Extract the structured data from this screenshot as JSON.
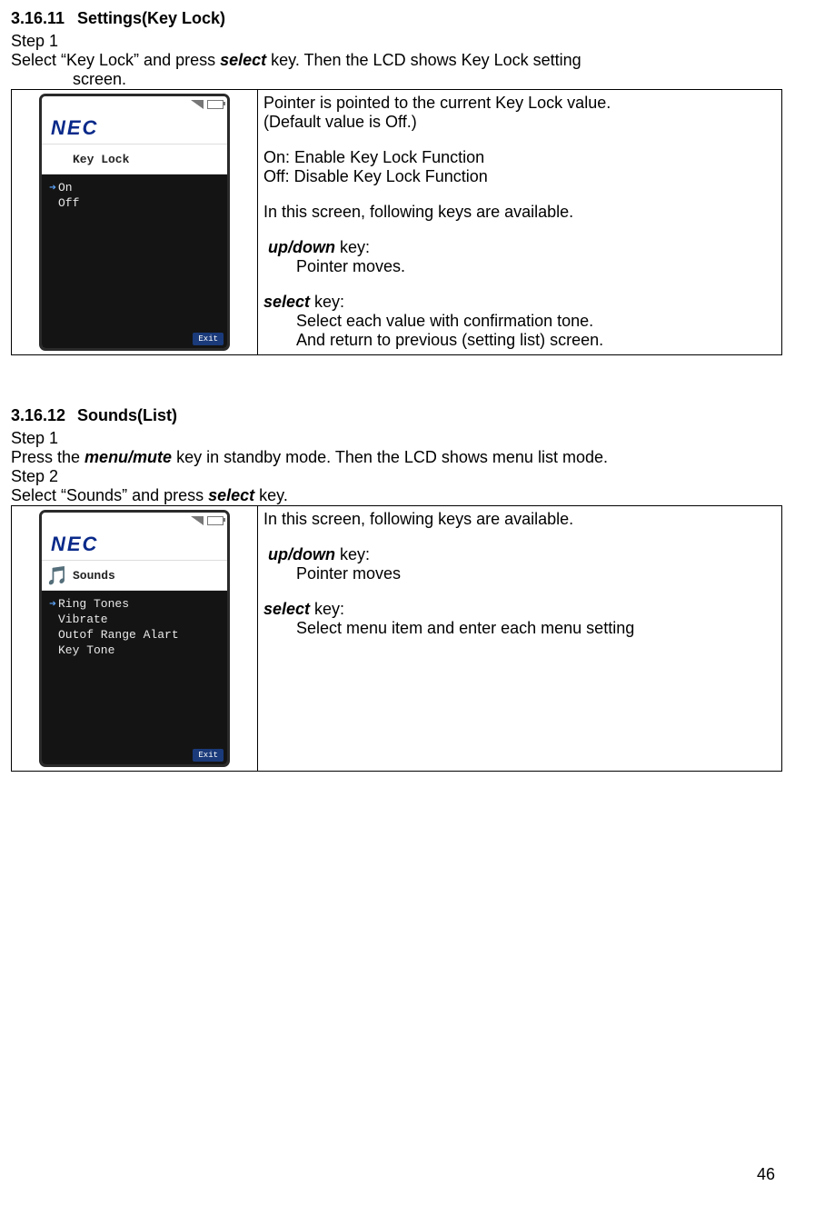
{
  "section1": {
    "number": "3.16.11",
    "title": "Settings(Key Lock)",
    "step1_label": "Step 1",
    "step1_text_a": "Select “Key Lock” and press ",
    "step1_key": "select",
    "step1_text_b": " key. Then the LCD shows Key Lock setting",
    "step1_line2": "screen.",
    "phone": {
      "logo": "NEC",
      "title": "Key Lock",
      "items": [
        "On",
        "Off"
      ],
      "exit": "Exit"
    },
    "desc": {
      "l1": "Pointer is pointed to the current Key Lock value.",
      "l2": "(Default value is Off.)",
      "l3": "On: Enable Key Lock Function",
      "l4": "Off: Disable Key Lock Function",
      "l5": "In this screen, following keys are available.",
      "k1": "up/down",
      "k1t": " key:",
      "k1d": "Pointer moves.",
      "k2": "select",
      "k2t": " key:",
      "k2d1": "Select each value with confirmation tone.",
      "k2d2": "And return to previous (setting list) screen."
    }
  },
  "section2": {
    "number": "3.16.12",
    "title": "Sounds(List)",
    "step1_label": "Step 1",
    "step1_a": "Press the ",
    "step1_key": "menu/mute",
    "step1_b": " key in standby mode.  Then the LCD shows menu list mode.",
    "step2_label": "Step 2",
    "step2_a": "Select  “Sounds” and press ",
    "step2_key": "select",
    "step2_b": " key.",
    "phone": {
      "logo": "NEC",
      "title": "Sounds",
      "items": [
        "Ring Tones",
        "Vibrate",
        "Outof Range Alart",
        "Key Tone"
      ],
      "exit": "Exit"
    },
    "desc": {
      "l1": "In this screen, following keys are available.",
      "k1": "up/down",
      "k1t": " key:",
      "k1d": "Pointer moves",
      "k2": "select",
      "k2t": " key:",
      "k2d": "Select menu item and enter each menu setting"
    }
  },
  "page_number": "46"
}
